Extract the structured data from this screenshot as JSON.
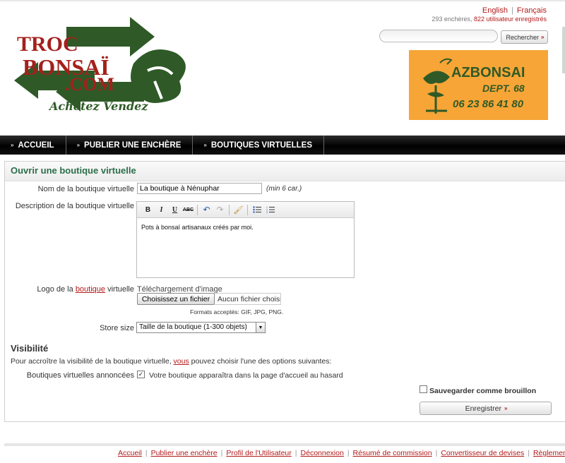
{
  "header": {
    "logo_text": "TROC BONSAÏ .COM",
    "logo_tagline": "Achetez Vendez",
    "languages": [
      "English",
      "Français"
    ],
    "stats": {
      "auctions": "293 enchères,",
      "users": "822 utilisateur enregistrés"
    },
    "search": {
      "placeholder": "",
      "button_label": "Rechercher"
    },
    "ad": {
      "name": "AZBONSAI",
      "dept": "DEPT. 68",
      "phone": "06 23 86 41 80"
    }
  },
  "nav": {
    "items": [
      {
        "label": "ACCUEIL"
      },
      {
        "label": "PUBLIER UNE ENCHÈRE"
      },
      {
        "label": "BOUTIQUES VIRTUELLES"
      }
    ]
  },
  "form": {
    "title": "Ouvrir une boutique virtuelle",
    "shop_name": {
      "label": "Nom de la boutique virtuelle",
      "value": "La boutique à Nénuphar",
      "hint": "(min 6 car.)"
    },
    "description": {
      "label": "Description de la boutique virtuelle",
      "value": "Pots à bonsaï artisanaux créés par moi."
    },
    "logo": {
      "label_pre": "Logo de la",
      "label_link": "boutique",
      "label_post": "virtuelle",
      "upload_label": "Téléchargement d'image",
      "choose_button": "Choisissez un fichier",
      "no_file": "Aucun fichier choisi",
      "formats": "Formats acceptés: GIF, JPG, PNG."
    },
    "store_size": {
      "label": "Store size",
      "selected": "Taille de la boutique (1-300 objets)"
    }
  },
  "visibility": {
    "title": "Visibilité",
    "desc_pre": "Pour accroître la visibilité de la boutique virtuelle,",
    "desc_link": "vous",
    "desc_post": "pouvez choisir l'une des options suivantes:",
    "featured_label": "Boutiques virtuelles annoncées",
    "featured_text": "Votre boutique apparaîtra dans la page d'accueil au hasard",
    "featured_checked": true
  },
  "actions": {
    "draft_label": "Sauvegarder comme brouillon",
    "draft_checked": false,
    "save_label": "Enregistrer"
  },
  "footer": {
    "links": [
      "Accueil",
      "Publier une enchère",
      "Profil de l'Utilisateur",
      "Déconnexion",
      "Résumé de commission",
      "Convertisseur de devises",
      "Règlement"
    ]
  }
}
